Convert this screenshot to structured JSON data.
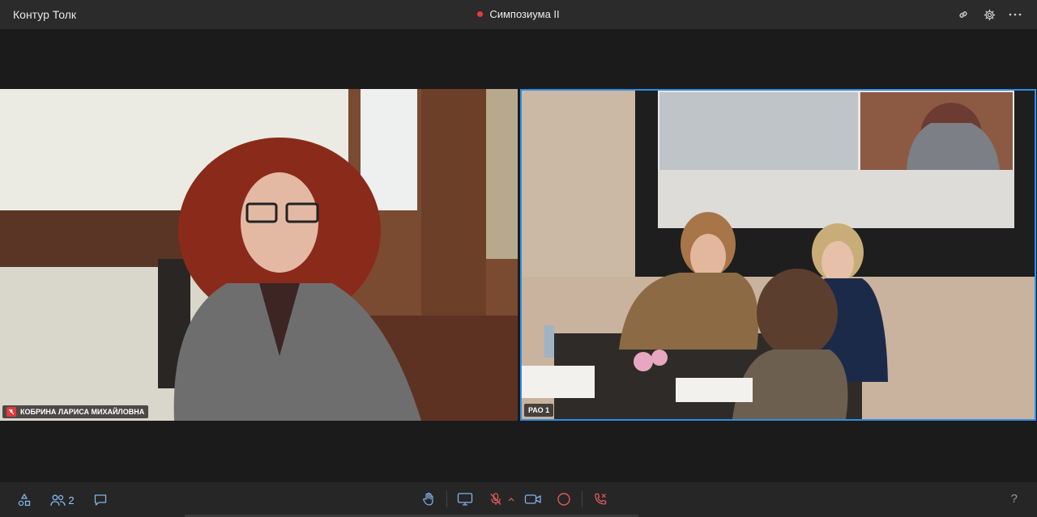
{
  "app": {
    "title": "Контур Толк"
  },
  "room": {
    "name": "Симпозиума II",
    "status_color": "#e8383c"
  },
  "top_icons": [
    "link-icon",
    "gear-icon",
    "more-icon"
  ],
  "participants": [
    {
      "name": "КОБРИНА ЛАРИСА МИХАЙЛОВНА",
      "mic": "off"
    },
    {
      "name": "РАО 1",
      "active_speaker": true
    }
  ],
  "toolbar": {
    "participant_count": "2",
    "help_label": "?"
  },
  "accent_color": "#2d8fe6"
}
